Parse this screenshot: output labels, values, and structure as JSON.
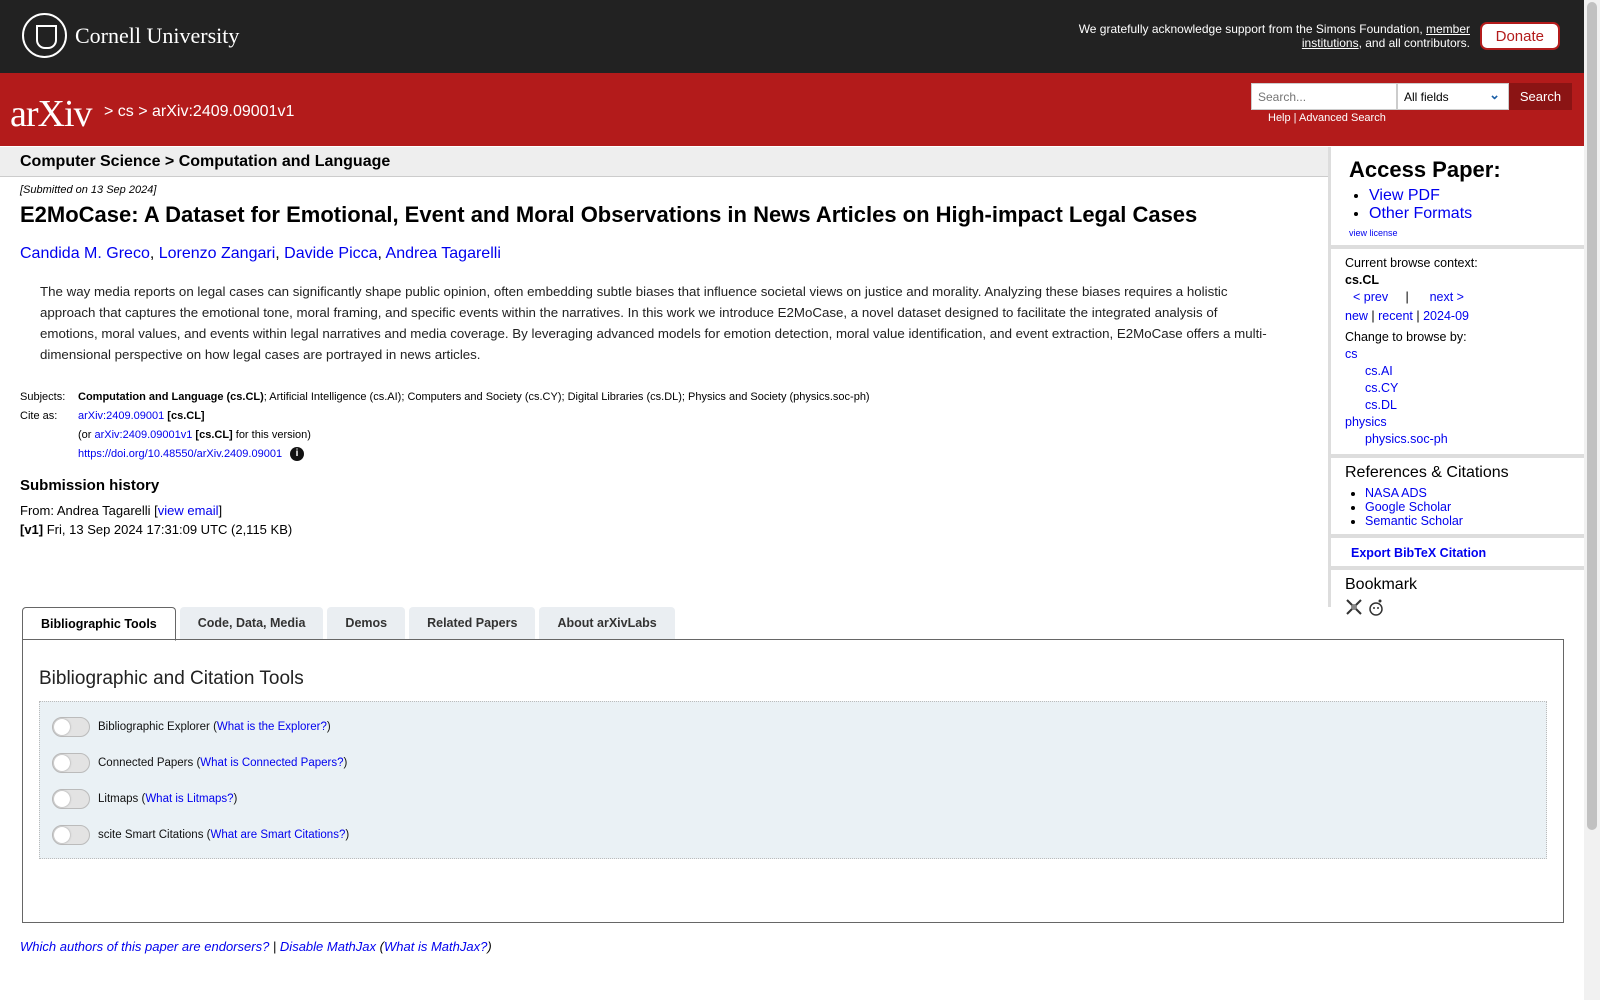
{
  "header": {
    "institution": "Cornell University",
    "support_text_1": "We gratefully acknowledge support from the Simons Foundation, ",
    "support_link": "member institutions",
    "support_text_2": ", and all contributors.",
    "donate_label": "Donate"
  },
  "nav": {
    "logo": "arXiv",
    "breadcrumb": "> cs > arXiv:2409.09001v1",
    "search_placeholder": "Search...",
    "search_field": "All fields",
    "search_button": "Search",
    "help": "Help",
    "advanced": "Advanced Search"
  },
  "subject_header": "Computer Science > Computation and Language",
  "paper": {
    "submitted": "[Submitted on 13 Sep 2024]",
    "title": "E2MoCase: A Dataset for Emotional, Event and Moral Observations in News Articles on High-impact Legal Cases",
    "authors": [
      "Candida M. Greco",
      "Lorenzo Zangari",
      "Davide Picca",
      "Andrea Tagarelli"
    ],
    "abstract": "The way media reports on legal cases can significantly shape public opinion, often embedding subtle biases that influence societal views on justice and morality. Analyzing these biases requires a holistic approach that captures the emotional tone, moral framing, and specific events within the narratives. In this work we introduce E2MoCase, a novel dataset designed to facilitate the integrated analysis of emotions, moral values, and events within legal narratives and media coverage. By leveraging advanced models for emotion detection, moral value identification, and event extraction, E2MoCase offers a multi-dimensional perspective on how legal cases are portrayed in news articles.",
    "subjects_label": "Subjects:",
    "subjects_primary": "Computation and Language (cs.CL)",
    "subjects_rest": "; Artificial Intelligence (cs.AI); Computers and Society (cs.CY); Digital Libraries (cs.DL); Physics and Society (physics.soc-ph)",
    "cite_label": "Cite as:",
    "cite_id": "arXiv:2409.09001",
    "cite_cat": "[cs.CL]",
    "cite_or": "(or ",
    "cite_version": "arXiv:2409.09001v1",
    "cite_version_cat": "[cs.CL]",
    "cite_version_tail": " for this version)",
    "doi": "https://doi.org/10.48550/arXiv.2409.09001",
    "info_icon": "i"
  },
  "history": {
    "heading": "Submission history",
    "from": "From: Andrea Tagarelli [",
    "view_email": "view email",
    "from_close": "]",
    "version_tag": "[v1]",
    "version_detail": " Fri, 13 Sep 2024 17:31:09 UTC (2,115 KB)"
  },
  "sidebar": {
    "access_heading": "Access Paper:",
    "access_links": [
      "View PDF",
      "Other Formats"
    ],
    "view_license": "view license",
    "context_label": "Current browse context:",
    "context_value": "cs.CL",
    "prev": "< prev",
    "sep": "|",
    "next": "next >",
    "new": "new",
    "recent": "recent",
    "date": "2024-09",
    "change_label": "Change to browse by:",
    "browse_cs": "cs",
    "browse_cs_sub": [
      "cs.AI",
      "cs.CY",
      "cs.DL"
    ],
    "browse_physics": "physics",
    "browse_physics_sub": [
      "physics.soc-ph"
    ],
    "refs_heading": "References & Citations",
    "refs_links": [
      "NASA ADS",
      "Google Scholar",
      "Semantic Scholar"
    ],
    "export_bibtex": "Export BibTeX Citation",
    "bookmark_heading": "Bookmark"
  },
  "tabs": [
    "Bibliographic Tools",
    "Code, Data, Media",
    "Demos",
    "Related Papers",
    "About arXivLabs"
  ],
  "tools": {
    "heading": "Bibliographic and Citation Tools",
    "items": [
      {
        "name": "Bibliographic Explorer",
        "help": "What is the Explorer?"
      },
      {
        "name": "Connected Papers",
        "help": "What is Connected Papers?"
      },
      {
        "name": "Litmaps",
        "help": "What is Litmaps?"
      },
      {
        "name": "scite Smart Citations",
        "help": "What are Smart Citations?"
      }
    ]
  },
  "footer": {
    "endorsers": "Which authors of this paper are endorsers?",
    "sep": " | ",
    "mathjax": "Disable MathJax",
    "what_mathjax": "What is MathJax?"
  }
}
